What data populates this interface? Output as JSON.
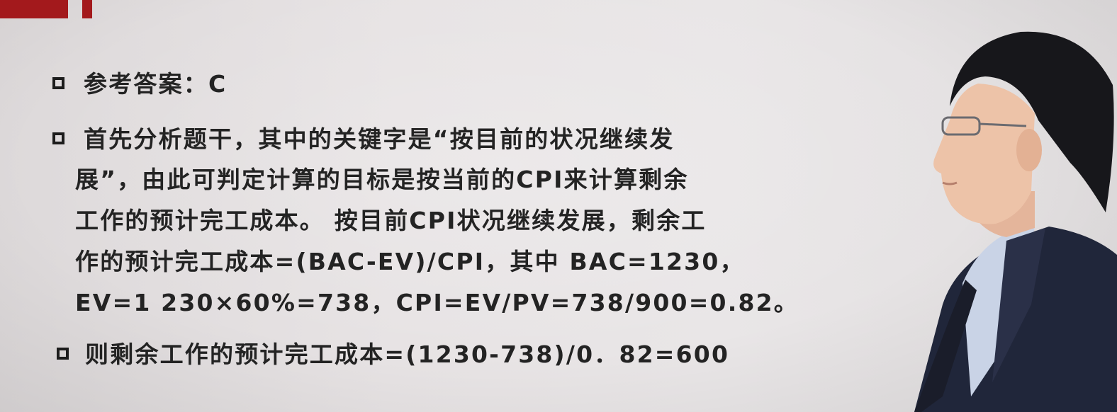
{
  "slide": {
    "bullets": [
      {
        "lines": [
          "参考答案：C"
        ]
      },
      {
        "lines": [
          "首先分析题干，其中的关键字是“按目前的状况继续发",
          "展”，由此可判定计算的目标是按当前的CPI来计算剩余",
          "工作的预计完工成本。 按目前CPI状况继续发展，剩余工",
          "作的预计完工成本=(BAC-EV)/CPI，其中 BAC=1230，",
          "EV=1 230×60%=738，CPI=EV/PV=738/900=0.82。"
        ]
      },
      {
        "lines": [
          "则剩余工作的预计完工成本=(1230-738)/0．82=600"
        ]
      }
    ]
  },
  "colors": {
    "accent": "#a3191c",
    "text": "#232323",
    "background": "#e7e3e4"
  }
}
